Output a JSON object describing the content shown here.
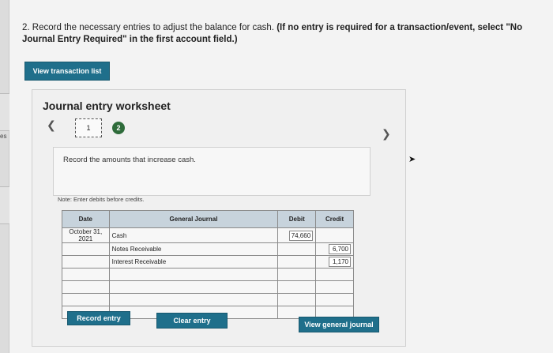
{
  "left_strip": {
    "fragment": "es"
  },
  "question": {
    "number": "2.",
    "text": "Record the necessary entries to adjust the balance for cash.",
    "instruction": "(If no entry is required for a transaction/event, select \"No Journal Entry Required\" in the first account field.)"
  },
  "buttons": {
    "view_transaction_list": "View transaction list",
    "record_entry": "Record entry",
    "clear_entry": "Clear entry",
    "view_general_journal": "View general journal"
  },
  "worksheet": {
    "title": "Journal entry worksheet",
    "steps": [
      "1",
      "2"
    ],
    "instruction": "Record the amounts that increase cash.",
    "note": "Note: Enter debits before credits."
  },
  "journal": {
    "headers": {
      "date": "Date",
      "account": "General Journal",
      "debit": "Debit",
      "credit": "Credit"
    },
    "rows": [
      {
        "date_line1": "October 31,",
        "date_line2": "2021",
        "account": "Cash",
        "debit": "74,660",
        "credit": "",
        "indent": false
      },
      {
        "date_line1": "",
        "date_line2": "",
        "account": "Notes Receivable",
        "debit": "",
        "credit": "6,700",
        "indent": true
      },
      {
        "date_line1": "",
        "date_line2": "",
        "account": "Interest Receivable",
        "debit": "",
        "credit": "1,170",
        "indent": true
      },
      {
        "date_line1": "",
        "date_line2": "",
        "account": "",
        "debit": "",
        "credit": "",
        "indent": false
      },
      {
        "date_line1": "",
        "date_line2": "",
        "account": "",
        "debit": "",
        "credit": "",
        "indent": false
      },
      {
        "date_line1": "",
        "date_line2": "",
        "account": "",
        "debit": "",
        "credit": "",
        "indent": false
      },
      {
        "date_line1": "",
        "date_line2": "",
        "account": "",
        "debit": "",
        "credit": "",
        "indent": false
      }
    ]
  },
  "colors": {
    "button_teal": "#1f6f8b",
    "step_active": "#2e6b3a",
    "table_header": "#c7d3dc"
  }
}
